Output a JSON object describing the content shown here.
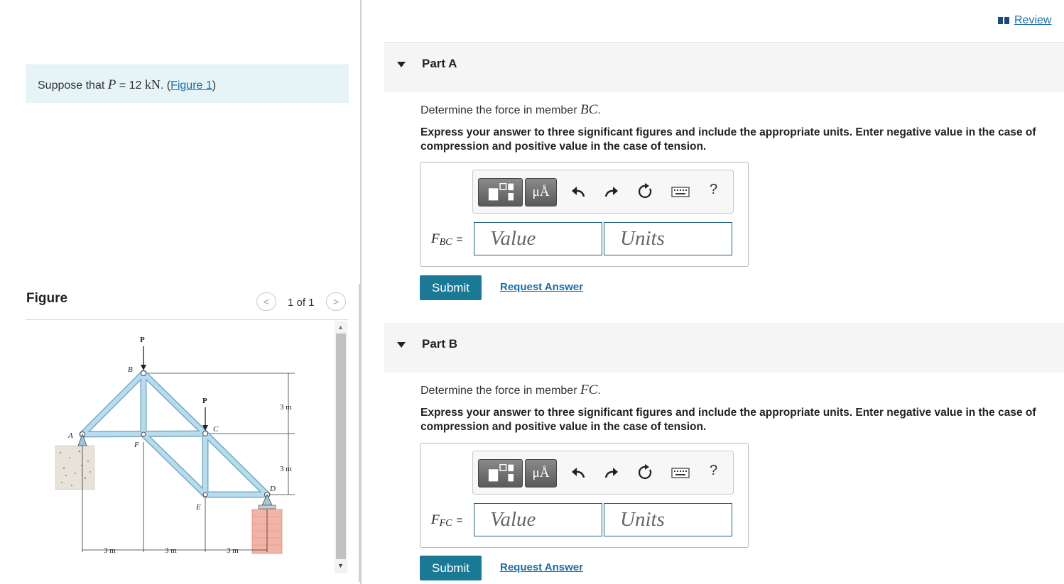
{
  "left": {
    "intro": {
      "prefix": "Suppose that ",
      "var": "P",
      "eq": " = 12 ",
      "unit": "kN",
      "period": ". (",
      "figure_link": "Figure 1",
      "close": ")"
    },
    "figure": {
      "label": "Figure",
      "counter": "1 of 1",
      "prev": "<",
      "next": ">",
      "diagram_labels": {
        "load_top": "P",
        "load_mid": "P",
        "node_a": "A",
        "node_b": "B",
        "node_c": "C",
        "node_d": "D",
        "node_e": "E",
        "node_f": "F",
        "height_upper": "3 m",
        "height_lower": "3 m",
        "span_1": "3 m",
        "span_2": "3 m",
        "span_3": "3 m"
      }
    }
  },
  "right": {
    "review_label": "Review",
    "parts": [
      {
        "title": "Part A",
        "question_prefix": "Determine the force in member ",
        "member": "BC",
        "question_suffix": ".",
        "instructions": "Express your answer to three significant figures and include the appropriate units. Enter negative value in the case of compression and positive value in the case of tension.",
        "units_button": "μÅ",
        "help": "?",
        "label_var": "F",
        "label_sub": "BC",
        "label_eq": "=",
        "value_placeholder": "Value",
        "units_placeholder": "Units",
        "submit": "Submit",
        "request": "Request Answer"
      },
      {
        "title": "Part B",
        "question_prefix": "Determine the force in member ",
        "member": "FC",
        "question_suffix": ".",
        "instructions": "Express your answer to three significant figures and include the appropriate units. Enter negative value in the case of compression and positive value in the case of tension.",
        "units_button": "μÅ",
        "help": "?",
        "label_var": "F",
        "label_sub": "FC",
        "label_eq": "=",
        "value_placeholder": "Value",
        "units_placeholder": "Units",
        "submit": "Submit",
        "request": "Request Answer"
      }
    ]
  },
  "colors": {
    "accent": "#1a7a96",
    "link": "#1a6ea8",
    "intro_bg": "#e6f4f7",
    "truss_member": "#9cc7dc"
  }
}
